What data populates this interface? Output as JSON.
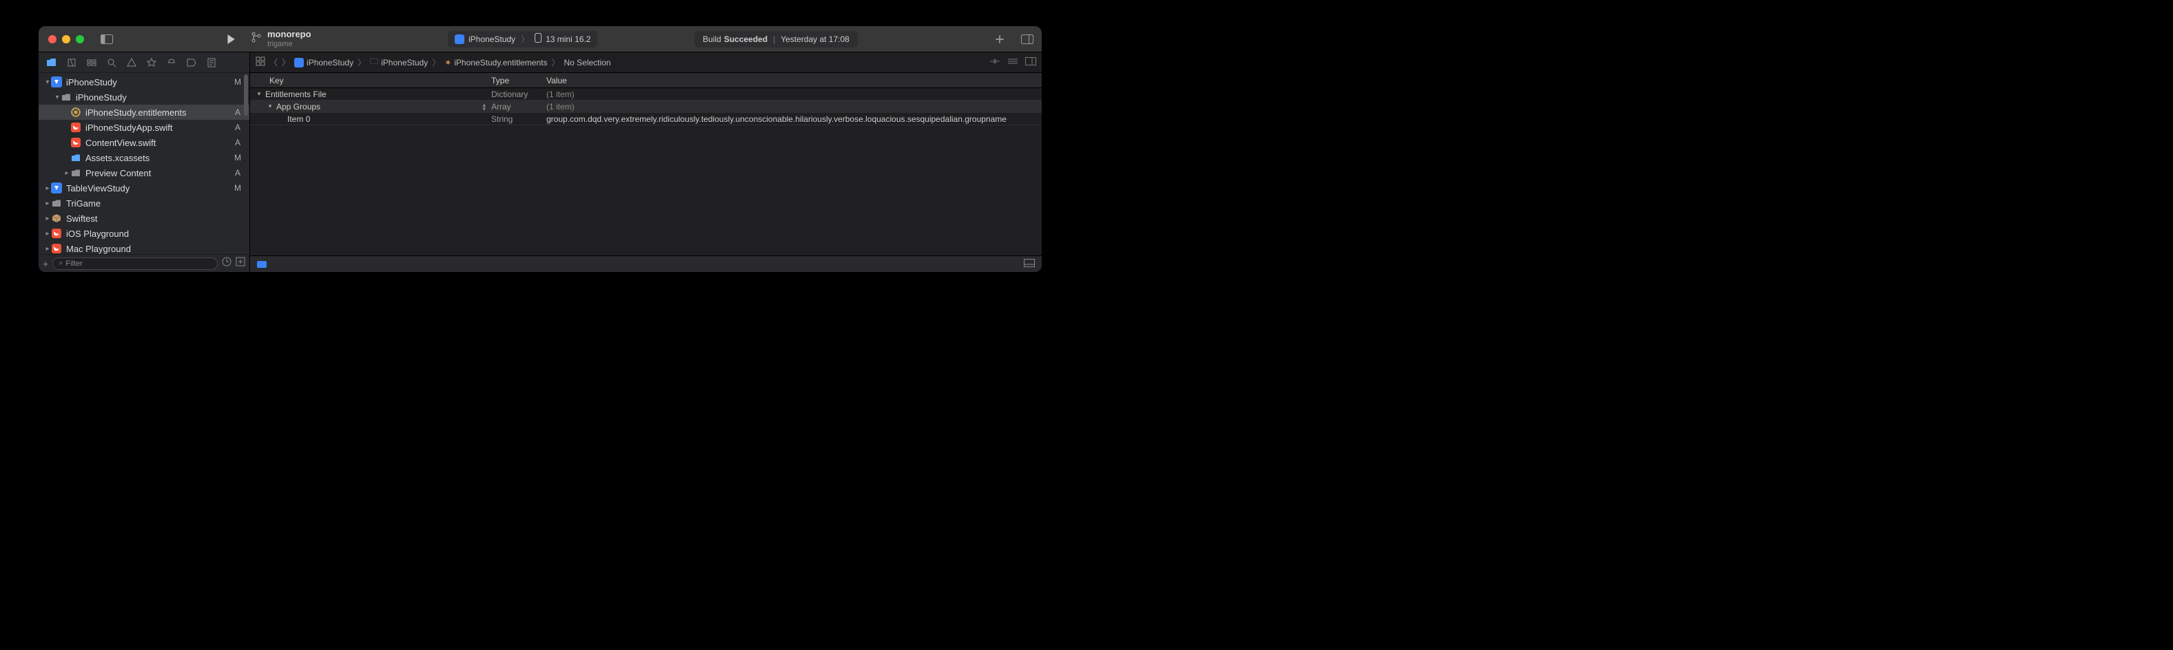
{
  "titlebar": {
    "branch_name": "monorepo",
    "branch_sub": "trigame",
    "scheme": "iPhoneStudy",
    "destination": "13 mini 16.2",
    "build_label": "Build",
    "build_result": "Succeeded",
    "build_time": "Yesterday at 17:08"
  },
  "sidebar": {
    "filter_placeholder": "Filter",
    "tree": [
      {
        "indent": 0,
        "chev": "▾",
        "icon": "proj",
        "label": "iPhoneStudy",
        "status": "M"
      },
      {
        "indent": 1,
        "chev": "▾",
        "icon": "folder",
        "label": "iPhoneStudy",
        "status": ""
      },
      {
        "indent": 2,
        "chev": "",
        "icon": "ent",
        "label": "iPhoneStudy.entitlements",
        "status": "A",
        "selected": true
      },
      {
        "indent": 2,
        "chev": "",
        "icon": "swift",
        "label": "iPhoneStudyApp.swift",
        "status": "A"
      },
      {
        "indent": 2,
        "chev": "",
        "icon": "swift",
        "label": "ContentView.swift",
        "status": "A"
      },
      {
        "indent": 2,
        "chev": "",
        "icon": "assets",
        "label": "Assets.xcassets",
        "status": "M"
      },
      {
        "indent": 2,
        "chev": "▸",
        "icon": "folder",
        "label": "Preview Content",
        "status": "A"
      },
      {
        "indent": 0,
        "chev": "▸",
        "icon": "proj",
        "label": "TableViewStudy",
        "status": "M"
      },
      {
        "indent": 0,
        "chev": "▸",
        "icon": "folder",
        "label": "TriGame",
        "status": ""
      },
      {
        "indent": 0,
        "chev": "▸",
        "icon": "pkg",
        "label": "Swiftest",
        "status": ""
      },
      {
        "indent": 0,
        "chev": "▸",
        "icon": "swift",
        "label": "iOS Playground",
        "status": ""
      },
      {
        "indent": 0,
        "chev": "▸",
        "icon": "swift",
        "label": "Mac Playground",
        "status": ""
      }
    ]
  },
  "jumpbar": {
    "crumbs": [
      "iPhoneStudy",
      "iPhoneStudy",
      "iPhoneStudy.entitlements",
      "No Selection"
    ]
  },
  "plist": {
    "headers": {
      "key": "Key",
      "type": "Type",
      "value": "Value"
    },
    "rows": [
      {
        "indent": 0,
        "tri": "▾",
        "key": "Entitlements File",
        "type": "Dictionary",
        "value": "(1 item)",
        "dim": true,
        "stepper": false
      },
      {
        "indent": 1,
        "tri": "▾",
        "key": "App Groups",
        "type": "Array",
        "value": "(1 item)",
        "dim": true,
        "sel": true,
        "stepper": true
      },
      {
        "indent": 2,
        "tri": "",
        "key": "Item 0",
        "type": "String",
        "value": "group.com.dqd.very.extremely.ridiculously.tediously.unconscionable.hilariously.verbose.loquacious.sesquipedalian.groupname",
        "dim": false,
        "stepper": false
      }
    ]
  }
}
